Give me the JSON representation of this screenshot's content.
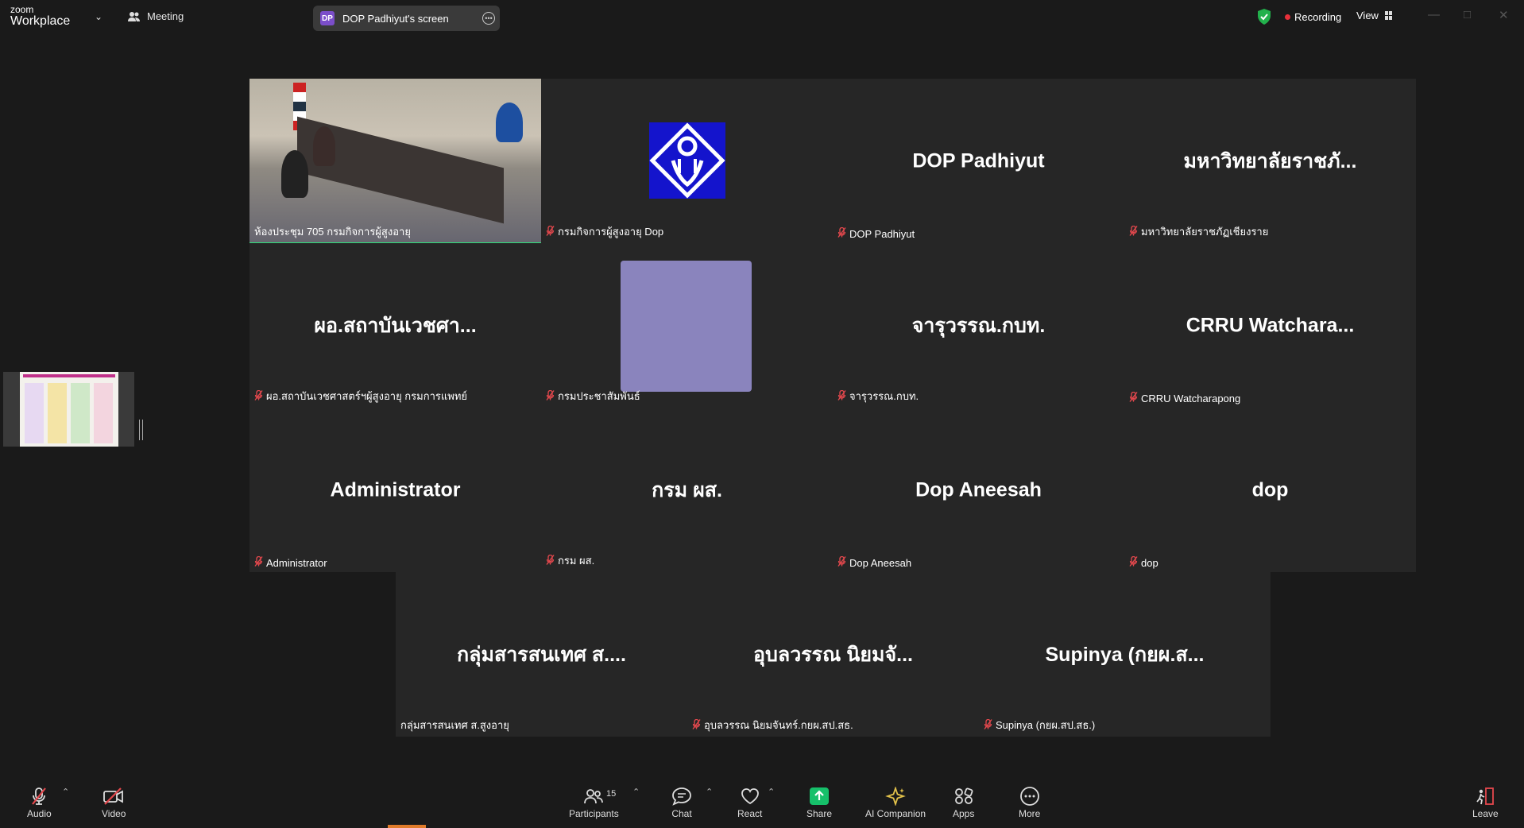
{
  "topbar": {
    "brand_small": "zoom",
    "brand_large": "Workplace",
    "meeting_label": "Meeting",
    "share_badge": "DP",
    "share_label": "DOP Padhiyut's screen",
    "recording_label": "Recording",
    "view_label": "View",
    "icons": [
      "chevron-down-icon",
      "meeting-people-icon",
      "more-icon",
      "shield-check-icon",
      "recording-dot-icon",
      "view-grid-icon",
      "minimize-icon",
      "maximize-icon",
      "close-icon"
    ]
  },
  "tiles": [
    {
      "display": "",
      "label": "ห้องประชุม 705 กรมกิจการผู้สูงอายุ",
      "muted": false,
      "kind": "video"
    },
    {
      "display": "",
      "label": "กรมกิจการผู้สูงอายุ Dop",
      "muted": true,
      "kind": "logo"
    },
    {
      "display": "DOP Padhiyut",
      "label": "DOP Padhiyut",
      "muted": true,
      "kind": "name"
    },
    {
      "display": "มหาวิทยาลัยราชภั...",
      "label": "มหาวิทยาลัยราชภัฏเชียงราย",
      "muted": true,
      "kind": "name"
    },
    {
      "display": "ผอ.สถาบันเวชศา...",
      "label": "ผอ.สถาบันเวชศาสตร์ฯผู้สูงอายุ กรมการแพทย์",
      "muted": true,
      "kind": "name"
    },
    {
      "display": "",
      "label": "กรมประชาสัมพันธ์",
      "muted": true,
      "kind": "avatar"
    },
    {
      "display": "จารุวรรณ.กบท.",
      "label": "จารุวรรณ.กบท.",
      "muted": true,
      "kind": "name"
    },
    {
      "display": "CRRU  Watchara...",
      "label": "CRRU Watcharapong",
      "muted": true,
      "kind": "name"
    },
    {
      "display": "Administrator",
      "label": "Administrator",
      "muted": true,
      "kind": "name"
    },
    {
      "display": "กรม ผส.",
      "label": "กรม ผส.",
      "muted": true,
      "kind": "name"
    },
    {
      "display": "Dop Aneesah",
      "label": "Dop Aneesah",
      "muted": true,
      "kind": "name"
    },
    {
      "display": "dop",
      "label": "dop",
      "muted": true,
      "kind": "name"
    },
    {
      "display": "กลุ่มสารสนเทศ ส....",
      "label": "กลุ่มสารสนเทศ ส.สูงอายุ",
      "muted": false,
      "kind": "name"
    },
    {
      "display": "อุบลวรรณ นิยมจั...",
      "label": "อุบลวรรณ นิยมจันทร์.กยผ.สป.สธ.",
      "muted": true,
      "kind": "name"
    },
    {
      "display": "Supinya (กยผ.ส...",
      "label": "Supinya (กยผ.สป.สธ.)",
      "muted": true,
      "kind": "name"
    }
  ],
  "toolbar": {
    "audio_label": "Audio",
    "video_label": "Video",
    "participants_label": "Participants",
    "participants_count": "15",
    "chat_label": "Chat",
    "react_label": "React",
    "share_label": "Share",
    "ai_label": "AI Companion",
    "apps_label": "Apps",
    "more_label": "More",
    "leave_label": "Leave"
  },
  "colors": {
    "background": "#1a1a1a",
    "tile": "#262626",
    "active_speaker": "#2ee07b",
    "share_green": "#16c06a",
    "recording_red": "#e8303a",
    "mute_red": "#e5484d"
  }
}
